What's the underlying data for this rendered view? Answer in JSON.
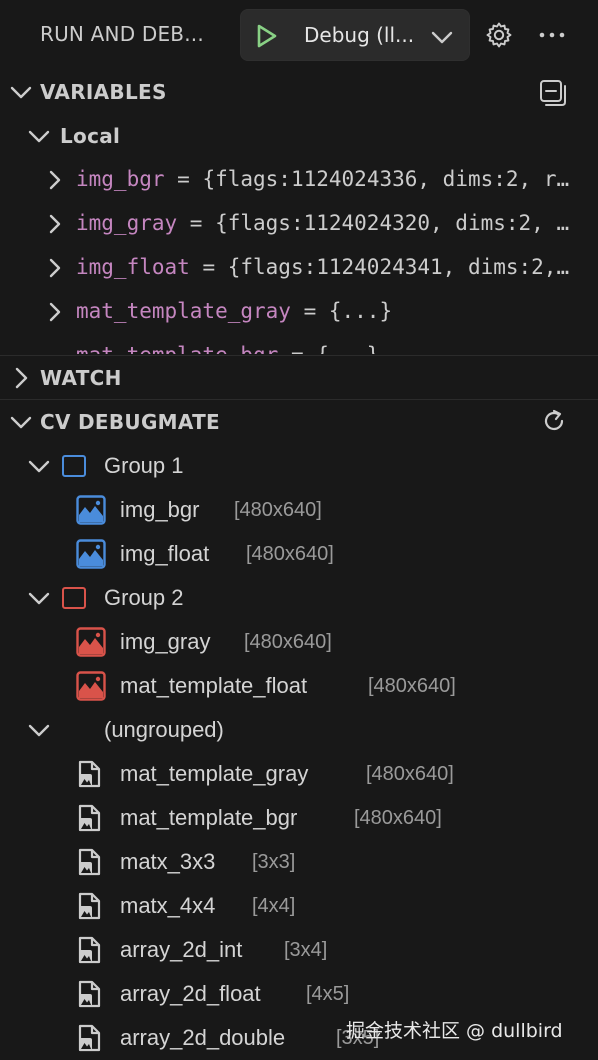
{
  "header": {
    "title": "RUN AND DEB...",
    "debug_config": "Debug (ll..."
  },
  "variables": {
    "title": "VARIABLES",
    "scope": "Local",
    "items": [
      {
        "name": "img_bgr",
        "value": "{flags:1124024336, dims:2, r…"
      },
      {
        "name": "img_gray",
        "value": "{flags:1124024320, dims:2, …"
      },
      {
        "name": "img_float",
        "value": "{flags:1124024341, dims:2,…"
      },
      {
        "name": "mat_template_gray",
        "value": "{...}"
      },
      {
        "name": "mat_template_bgr",
        "value": "{...}"
      }
    ]
  },
  "watch": {
    "title": "WATCH"
  },
  "debugmate": {
    "title": "CV DEBUGMATE",
    "groups": [
      {
        "label": "Group 1",
        "color": "#4a8cdb",
        "items": [
          {
            "name": "img_bgr",
            "dims": "[480x640]"
          },
          {
            "name": "img_float",
            "dims": "[480x640]"
          }
        ]
      },
      {
        "label": "Group 2",
        "color": "#d9534a",
        "items": [
          {
            "name": "img_gray",
            "dims": "[480x640]"
          },
          {
            "name": "mat_template_float",
            "dims": "[480x640]"
          }
        ]
      }
    ],
    "ungrouped": {
      "label": "(ungrouped)",
      "items": [
        {
          "name": "mat_template_gray",
          "dims": "[480x640]"
        },
        {
          "name": "mat_template_bgr",
          "dims": "[480x640]"
        },
        {
          "name": "matx_3x3",
          "dims": "[3x3]"
        },
        {
          "name": "matx_4x4",
          "dims": "[4x4]"
        },
        {
          "name": "array_2d_int",
          "dims": "[3x4]"
        },
        {
          "name": "array_2d_float",
          "dims": "[4x5]"
        },
        {
          "name": "array_2d_double",
          "dims": "[3x5]"
        }
      ]
    }
  },
  "watermark": "掘金技术社区 @ dullbird"
}
